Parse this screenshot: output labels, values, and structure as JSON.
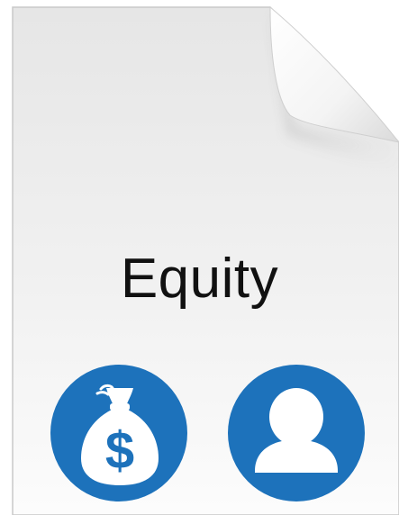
{
  "document": {
    "title": "Equity",
    "icons": [
      {
        "name": "money-bag-icon",
        "symbol": "$"
      },
      {
        "name": "person-icon"
      }
    ]
  },
  "colors": {
    "icon_blue": "#1d72bb",
    "page_top": "#e9e9e9",
    "page_bottom": "#fbfbfb",
    "text": "#111111"
  }
}
